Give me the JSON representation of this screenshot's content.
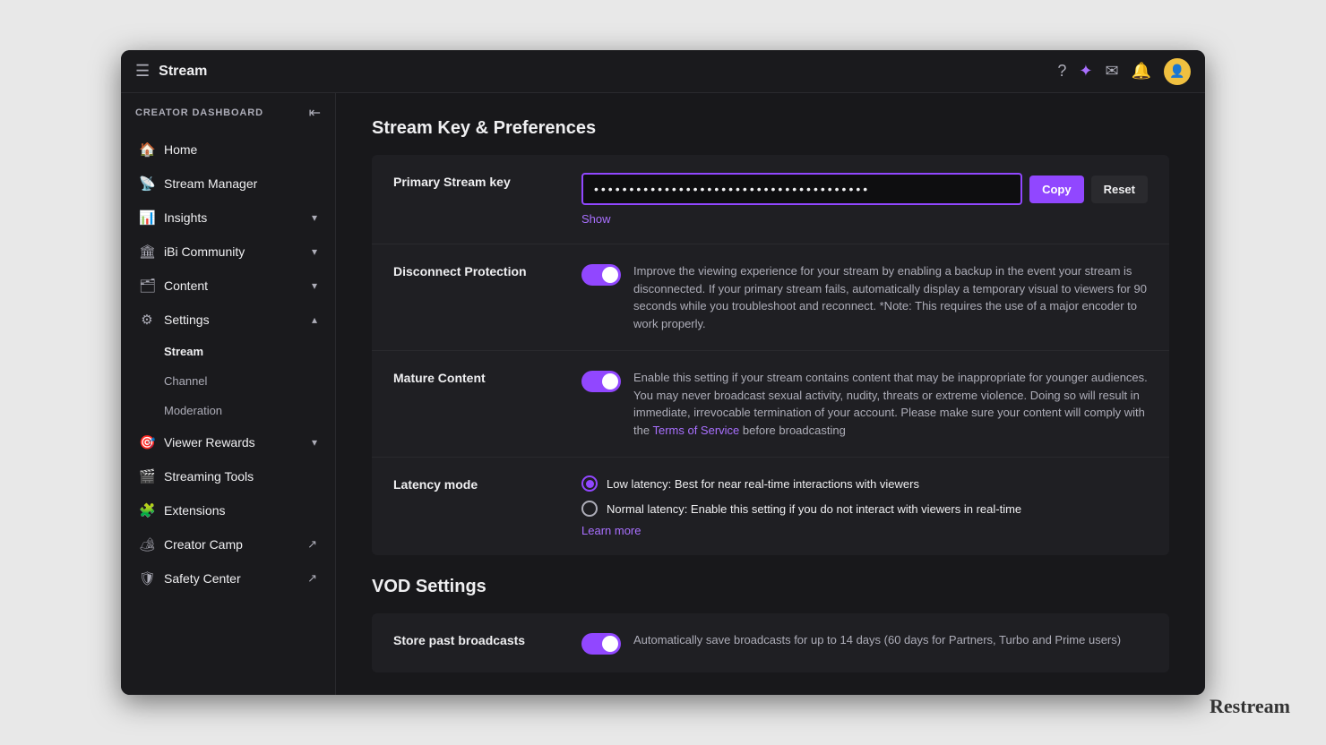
{
  "window": {
    "title": "Stream"
  },
  "titlebar": {
    "title": "Stream",
    "icons": [
      "help-icon",
      "premium-icon",
      "mail-icon",
      "notification-icon",
      "user-icon"
    ]
  },
  "sidebar": {
    "header": "Creator Dashboard",
    "items": [
      {
        "id": "home",
        "label": "Home",
        "icon": "🏠",
        "hasChevron": false
      },
      {
        "id": "stream-manager",
        "label": "Stream Manager",
        "icon": "📡",
        "hasChevron": false
      },
      {
        "id": "insights",
        "label": "Insights",
        "icon": "📊",
        "hasChevron": true
      },
      {
        "id": "community",
        "label": "iBi Community",
        "icon": "🏛",
        "hasChevron": true
      },
      {
        "id": "content",
        "label": "Content",
        "icon": "🗂",
        "hasChevron": true
      },
      {
        "id": "settings",
        "label": "Settings",
        "icon": "⚙",
        "hasChevron": true,
        "expanded": true
      }
    ],
    "sub_items": [
      {
        "id": "stream",
        "label": "Stream",
        "active": true
      },
      {
        "id": "channel",
        "label": "Channel",
        "active": false
      },
      {
        "id": "moderation",
        "label": "Moderation",
        "active": false
      }
    ],
    "bottom_items": [
      {
        "id": "viewer-rewards",
        "label": "Viewer Rewards",
        "icon": "🎯",
        "hasChevron": true
      },
      {
        "id": "streaming-tools",
        "label": "Streaming Tools",
        "icon": "🎬",
        "hasChevron": false
      },
      {
        "id": "extensions",
        "label": "Extensions",
        "icon": "🧩",
        "hasChevron": false
      },
      {
        "id": "creator-camp",
        "label": "Creator Camp",
        "icon": "🏕",
        "hasExternal": true
      },
      {
        "id": "safety-center",
        "label": "Safety Center",
        "icon": "🛡",
        "hasExternal": true
      }
    ]
  },
  "main": {
    "page_title": "Stream Key & Preferences",
    "stream_key_section": {
      "label": "Primary Stream key",
      "key_placeholder": "●●●●●●●●●●●●●●●●●●●●●●●●●●●●●●●●●●●●●●●●",
      "copy_label": "Copy",
      "reset_label": "Reset",
      "show_label": "Show"
    },
    "disconnect_protection": {
      "label": "Disconnect Protection",
      "enabled": true,
      "description": "Improve the viewing experience for your stream by enabling a backup in the event your stream is disconnected. If your primary stream fails, automatically display a temporary visual to viewers for 90 seconds while you troubleshoot and reconnect. *Note: This requires the use of a major encoder to work properly."
    },
    "mature_content": {
      "label": "Mature Content",
      "enabled": true,
      "description": "Enable this setting if your stream contains content that may be inappropriate for younger audiences. You may never broadcast sexual activity, nudity, threats or extreme violence. Doing so will result in immediate, irrevocable termination of your account. Please make sure your content will comply with the",
      "terms_link": "Terms of Service",
      "description_after": "before broadcasting"
    },
    "latency_mode": {
      "label": "Latency mode",
      "options": [
        {
          "id": "low",
          "label": "Low latency: Best for near real-time interactions with viewers",
          "selected": true
        },
        {
          "id": "normal",
          "label": "Normal latency: Enable this setting if you do not interact with viewers in real-time",
          "selected": false
        }
      ],
      "learn_more": "Learn more"
    },
    "vod_settings": {
      "title": "VOD Settings",
      "store_broadcasts": {
        "label": "Store past broadcasts",
        "enabled": true,
        "description": "Automatically save broadcasts for up to 14 days (60 days for Partners, Turbo and Prime users)"
      }
    }
  },
  "watermark": "Restream"
}
